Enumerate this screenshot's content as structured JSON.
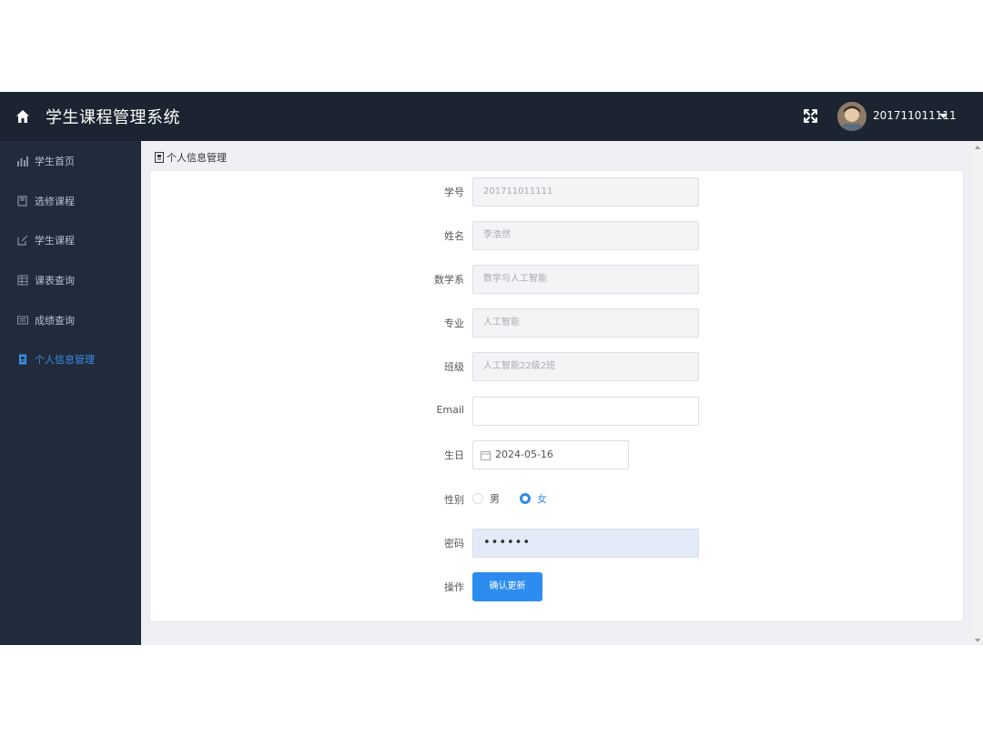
{
  "header": {
    "title": "学生课程管理系统",
    "username": "201711011111",
    "icons": {
      "home": "home-icon",
      "fullscreen": "fullscreen-icon",
      "caret": "caret-down-icon"
    }
  },
  "sidebar": {
    "active_color": "#3a8ee6",
    "items": [
      {
        "label": "学生首页",
        "icon": "bar-chart-icon",
        "active": false
      },
      {
        "label": "选修课程",
        "icon": "book-icon",
        "active": false
      },
      {
        "label": "学生课程",
        "icon": "edit-icon",
        "active": false
      },
      {
        "label": "课表查询",
        "icon": "table-icon",
        "active": false
      },
      {
        "label": "成绩查询",
        "icon": "list-icon",
        "active": false
      },
      {
        "label": "个人信息管理",
        "icon": "profile-icon",
        "active": true
      }
    ]
  },
  "breadcrumb": {
    "text": "个人信息管理",
    "icon": "profile-icon"
  },
  "form": {
    "student_id": {
      "label": "学号",
      "value": "201711011111"
    },
    "name": {
      "label": "姓名",
      "value": "李浩然"
    },
    "department": {
      "label": "数学系",
      "value": "数学与人工智能"
    },
    "major": {
      "label": "专业",
      "value": "人工智能"
    },
    "class": {
      "label": "班级",
      "value": "人工智能22级2班"
    },
    "email": {
      "label": "Email",
      "value": ""
    },
    "birthday": {
      "label": "生日",
      "value": "2024-05-16"
    },
    "gender": {
      "label": "性别",
      "options": [
        "男",
        "女"
      ],
      "selected": "女"
    },
    "password": {
      "label": "密码",
      "value": "••••••"
    },
    "action": {
      "label": "操作",
      "button": "确认更新"
    }
  },
  "colors": {
    "topbar": "#1b2430",
    "sidebar": "#212b3b",
    "primary": "#2d8cf0"
  }
}
